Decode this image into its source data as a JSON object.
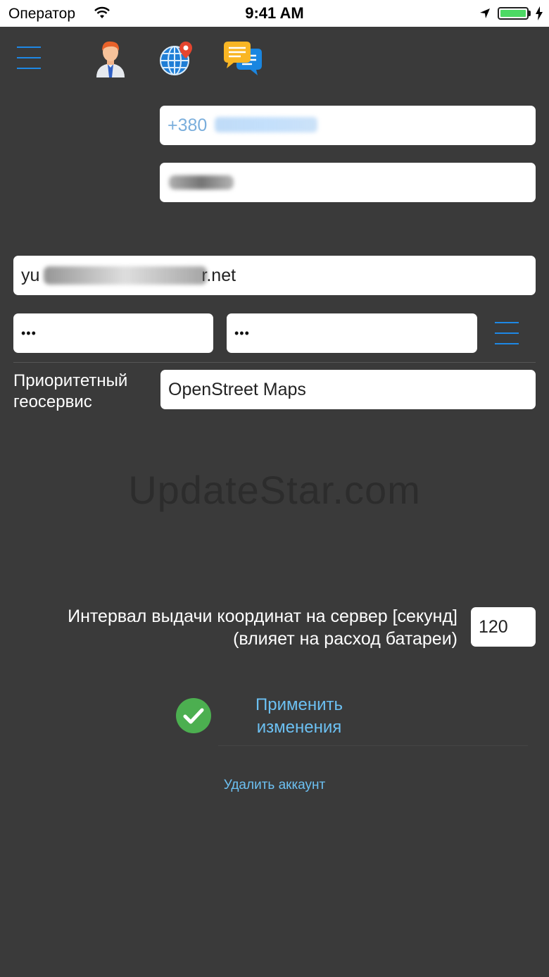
{
  "status_bar": {
    "carrier": "Оператор",
    "time": "9:41 AM",
    "icons": [
      "wifi-icon",
      "location-arrow-icon",
      "battery-icon",
      "charging-bolt-icon"
    ]
  },
  "toolbar": {
    "icons": [
      "menu-icon",
      "profile-icon",
      "globe-location-icon",
      "chat-bubbles-icon"
    ],
    "accent_color": "#1e88e5"
  },
  "form": {
    "phone_value": "+380",
    "name_value": "",
    "email_value_start": "yu",
    "email_value_end": "r.net",
    "password_value": "•••",
    "password_confirm_value": "•••",
    "geoservice_label": "Приоритетный геосервис",
    "geoservice_value": "OpenStreet Maps",
    "interval_label_line1": "Интервал выдачи координат на сервер [секунд]",
    "interval_label_line2": "(влияет на расход батареи)",
    "interval_value": "120"
  },
  "watermark": "UpdateStar.com",
  "actions": {
    "apply_line1": "Применить",
    "apply_line2": "изменения",
    "delete_account": "Удалить аккаунт"
  },
  "colors": {
    "background": "#3a3a3a",
    "link": "#6cc0f2",
    "check": "#4caf50"
  }
}
